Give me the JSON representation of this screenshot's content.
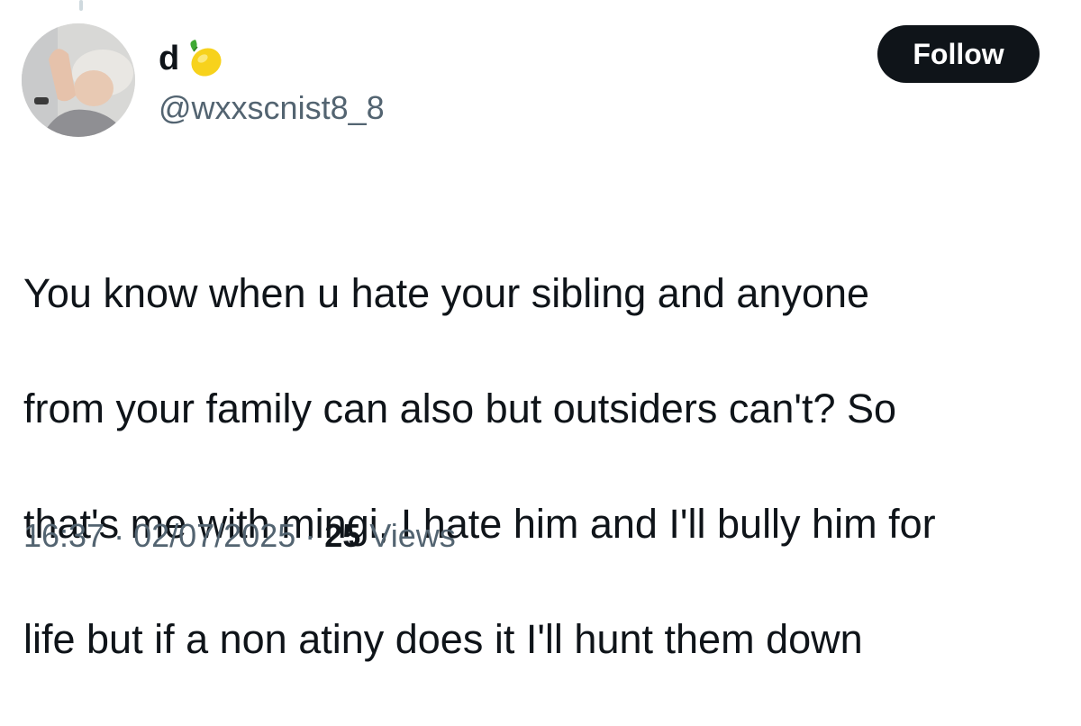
{
  "tweet": {
    "author": {
      "display_name": "d",
      "name_emoji": "lemon-icon",
      "handle": "@wxxscnist8_8"
    },
    "follow_label": "Follow",
    "text_lines": [
      "You know when u hate your sibling and anyone",
      "from your family can also but outsiders can't? So",
      "that's me with mingi, I hate him and I'll bully him for",
      "life but if a non atiny does it I'll hunt them down"
    ],
    "time": "16:37",
    "separator": "·",
    "date": "02/07/2025",
    "views_count": "25",
    "views_label": "Views"
  },
  "colors": {
    "text_primary": "#0f1419",
    "text_secondary": "#536471",
    "button_bg": "#0f1419",
    "button_text": "#ffffff"
  }
}
